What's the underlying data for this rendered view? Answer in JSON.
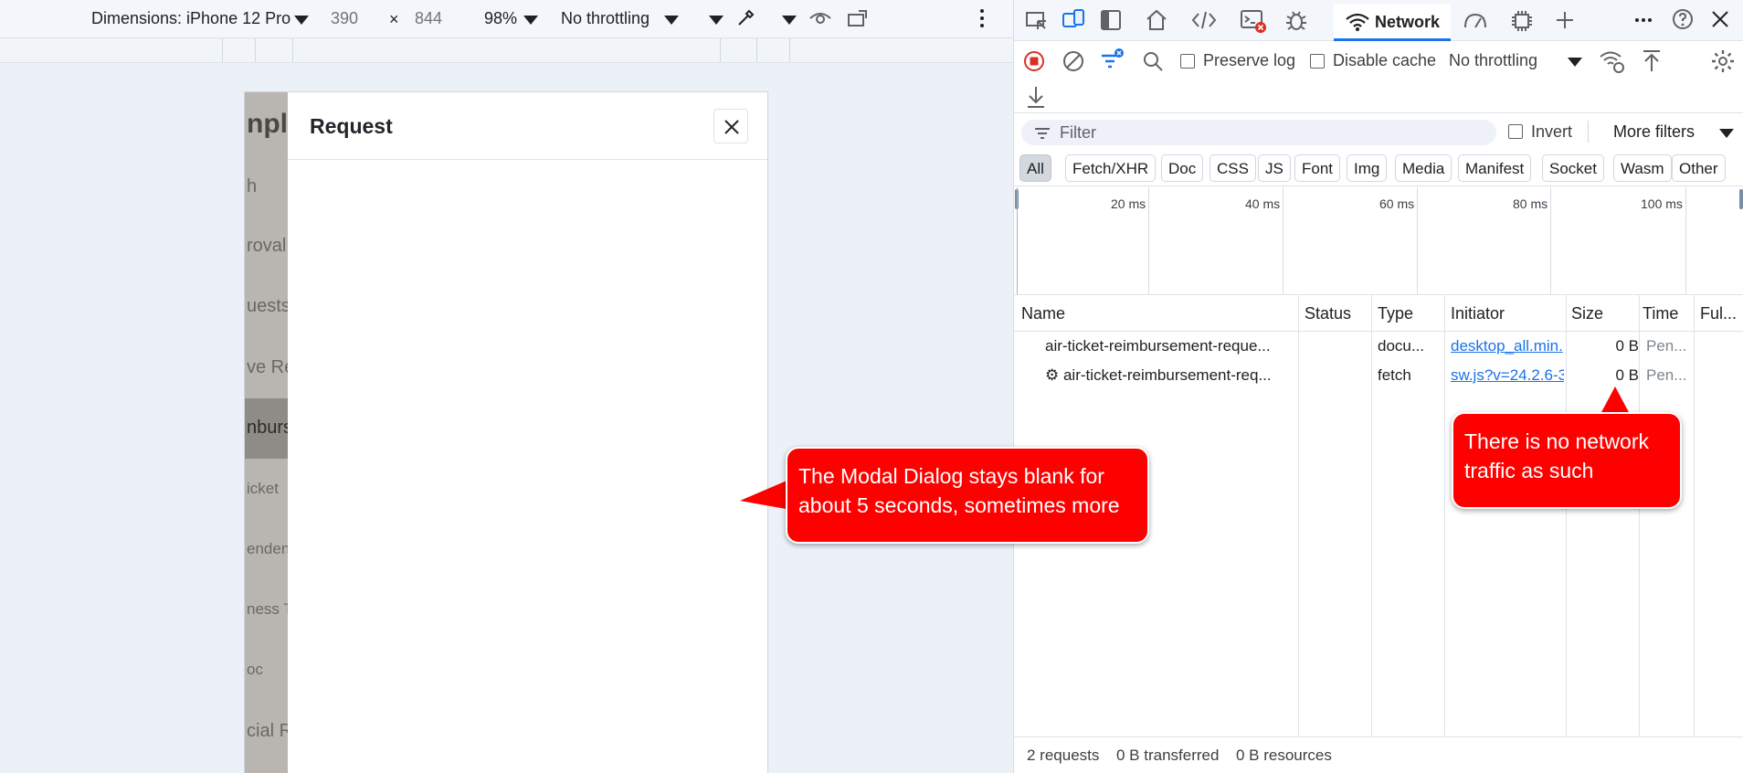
{
  "device_toolbar": {
    "dimensions_label": "Dimensions: iPhone 12 Pro",
    "width": "390",
    "times": "×",
    "height": "844",
    "zoom": "98%",
    "throttling": "No throttling"
  },
  "modal": {
    "title": "Request"
  },
  "background_page": {
    "logo_fragment": "nplo",
    "items": [
      "h",
      "roval",
      "uests",
      "ve Re",
      "nburs",
      "icket",
      "endent",
      "ness Tr",
      "oc",
      "cial Re"
    ]
  },
  "devtools": {
    "active_tab": "Network",
    "toolbar": {
      "preserve_log": "Preserve log",
      "disable_cache": "Disable cache",
      "throttling": "No throttling"
    },
    "filter": {
      "placeholder": "Filter",
      "invert": "Invert",
      "more_filters": "More filters"
    },
    "type_filters": [
      "All",
      "Fetch/XHR",
      "Doc",
      "CSS",
      "JS",
      "Font",
      "Img",
      "Media",
      "Manifest",
      "Socket",
      "Wasm",
      "Other"
    ],
    "timeline_labels": [
      "20 ms",
      "40 ms",
      "60 ms",
      "80 ms",
      "100 ms"
    ],
    "columns": [
      "Name",
      "Status",
      "Type",
      "Initiator",
      "Size",
      "Time",
      "Ful..."
    ],
    "rows": [
      {
        "name": "air-ticket-reimbursement-reque...",
        "status": "",
        "type": "docu...",
        "initiator": "desktop_all.min.",
        "size": "0 B",
        "time": "Pen..."
      },
      {
        "name": "⚙ air-ticket-reimbursement-req...",
        "status": "",
        "type": "fetch",
        "initiator": "sw.js?v=24.2.6-3",
        "size": "0 B",
        "time": "Pen..."
      }
    ],
    "status_bar": {
      "requests": "2 requests",
      "transferred": "0 B transferred",
      "resources": "0 B resources"
    }
  },
  "callouts": {
    "modal_blank": "The Modal Dialog stays blank for\nabout 5 seconds, sometimes more",
    "no_traffic": "There is no network\ntraffic as such"
  },
  "colors": {
    "callout_red": "#ff0000",
    "devtools_accent": "#1a73e8",
    "record_red": "#d93025"
  }
}
